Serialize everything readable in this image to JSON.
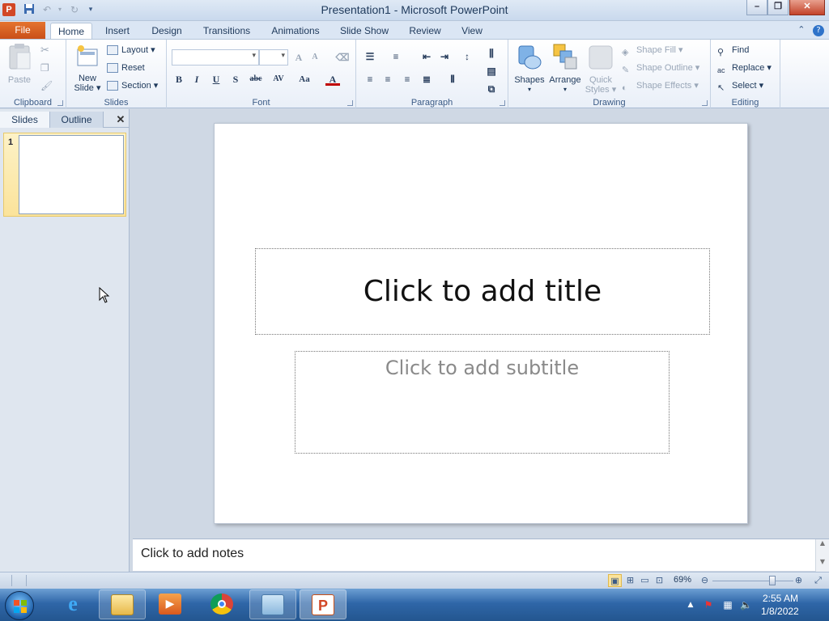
{
  "window": {
    "title": "Presentation1  -  Microsoft PowerPoint",
    "app_icon": "P",
    "minimize": "–",
    "maximize": "❐",
    "close": "✕"
  },
  "tabs": {
    "file": "File",
    "items": [
      "Home",
      "Insert",
      "Design",
      "Transitions",
      "Animations",
      "Slide Show",
      "Review",
      "View"
    ],
    "active": "Home"
  },
  "ribbon": {
    "clipboard": {
      "label": "Clipboard",
      "paste": "Paste"
    },
    "slides": {
      "label": "Slides",
      "new_slide": "New",
      "new_slide2": "Slide",
      "layout": "Layout",
      "reset": "Reset",
      "section": "Section"
    },
    "font": {
      "label": "Font",
      "bold": "B",
      "italic": "I",
      "underline": "U",
      "shadow": "S",
      "strike": "abc",
      "spacing": "AV",
      "case": "Aa",
      "color": "A",
      "grow": "A",
      "shrink": "A"
    },
    "paragraph": {
      "label": "Paragraph"
    },
    "drawing": {
      "label": "Drawing",
      "shapes": "Shapes",
      "arrange": "Arrange",
      "quick1": "Quick",
      "quick2": "Styles",
      "shape_fill": "Shape Fill",
      "shape_outline": "Shape Outline",
      "shape_effects": "Shape Effects"
    },
    "editing": {
      "label": "Editing",
      "find": "Find",
      "replace": "Replace",
      "select": "Select"
    }
  },
  "left_pane": {
    "tab_slides": "Slides",
    "tab_outline": "Outline",
    "close": "✕",
    "thumb_number": "1"
  },
  "slide": {
    "title_placeholder": "Click to add title",
    "subtitle_placeholder": "Click to add subtitle"
  },
  "notes": {
    "placeholder": "Click to add notes"
  },
  "status": {
    "zoom": "69%",
    "zoom_fraction": 0.42
  },
  "taskbar": {
    "time": "2:55 AM",
    "date": "1/8/2022"
  },
  "colors": {
    "file_tab": "#d24726",
    "accent": "#1e395b",
    "thumb_highlight": "#fbe39a"
  }
}
